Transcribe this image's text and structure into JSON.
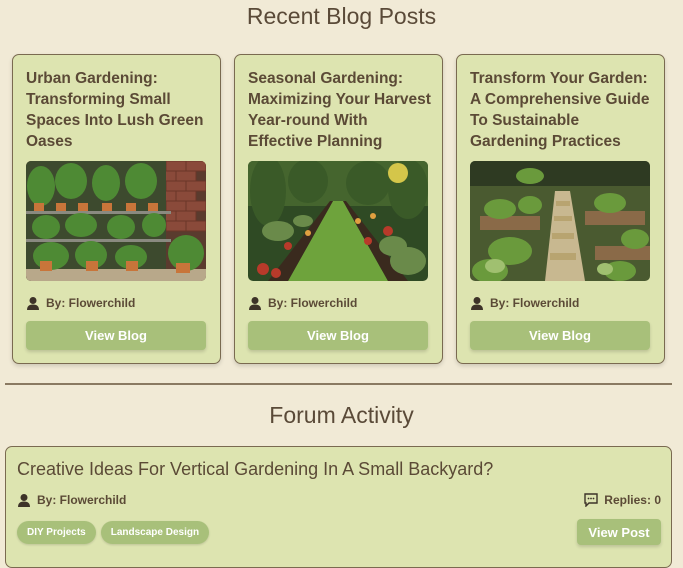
{
  "blog_section": {
    "title": "Recent Blog Posts",
    "posts": [
      {
        "title": "Urban Gardening: Transforming Small Spaces Into Lush Green Oases",
        "author": "By: Flowerchild",
        "button": "View Blog",
        "image_alt": "potted plants on shelves against brick wall"
      },
      {
        "title": "Seasonal Gardening: Maximizing Your Harvest Year-round With Effective Planning",
        "author": "By: Flowerchild",
        "button": "View Blog",
        "image_alt": "garden path lined with flower beds"
      },
      {
        "title": "Transform Your Garden: A Comprehensive Guide To Sustainable Gardening Practices",
        "author": "By: Flowerchild",
        "button": "View Blog",
        "image_alt": "raised garden beds with stepping path"
      }
    ]
  },
  "forum_section": {
    "title": "Forum Activity",
    "post": {
      "title": "Creative Ideas For Vertical Gardening In A Small Backyard?",
      "author": "By: Flowerchild",
      "replies": "Replies: 0",
      "tags": [
        "DIY Projects",
        "Landscape Design"
      ],
      "button": "View Post"
    }
  },
  "icons": {
    "author": "user-icon",
    "replies": "comment-icon"
  },
  "colors": {
    "background": "#f1ead6",
    "card": "#dde4b0",
    "accent": "#a8c07a",
    "text": "#5b4a36"
  }
}
